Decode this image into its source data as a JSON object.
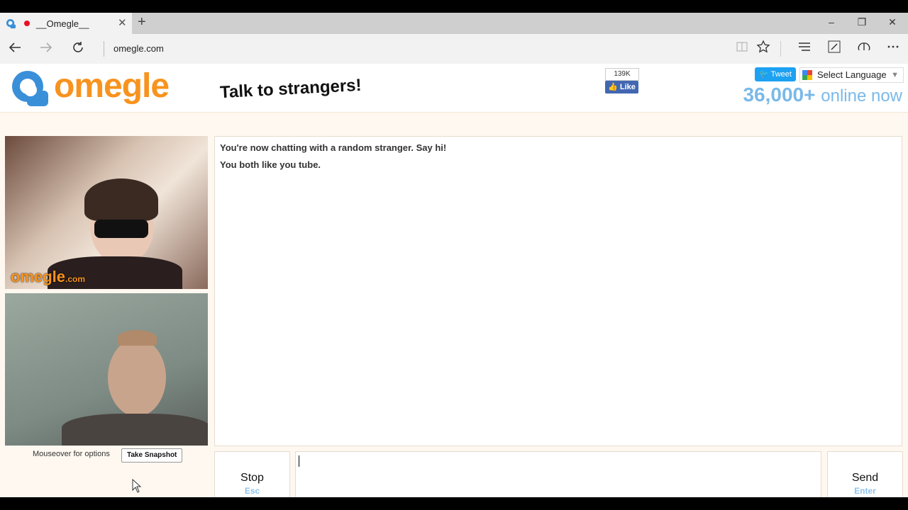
{
  "browser": {
    "tab_title": "__Omegle__",
    "tab_close": "✕",
    "new_tab": "+",
    "address": "omegle.com",
    "window_controls": [
      "–",
      "❐",
      "✕"
    ]
  },
  "header": {
    "logo_text": "omegle",
    "tagline": "Talk to strangers!",
    "fb_count": "139K",
    "fb_like": "Like",
    "tweet": "Tweet",
    "language": "Select Language",
    "online_count": "36,000+",
    "online_label": "online now"
  },
  "video": {
    "watermark": "omegle",
    "watermark_suffix": ".com"
  },
  "controls": {
    "options_label": "Mouseover for options",
    "snapshot_button": "Take Snapshot"
  },
  "chat": {
    "messages": [
      "You're now chatting with a random stranger. Say hi!",
      "You both like you tube."
    ],
    "stop_label": "Stop",
    "stop_hint": "Esc",
    "send_label": "Send",
    "send_hint": "Enter"
  },
  "colors": {
    "brand_orange": "#f7931e",
    "online_blue": "#7ab9e8"
  }
}
